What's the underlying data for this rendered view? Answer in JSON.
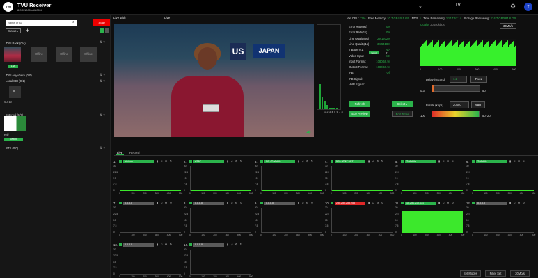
{
  "header": {
    "logo": "TVU",
    "title": "TVU Receiver",
    "version": "8.0.0.1000build0016",
    "user": "TVI",
    "avatar": "T"
  },
  "sidebar": {
    "search_placeholder": "Name or ID",
    "stop_label": "Stop",
    "status_label": "Status ▾",
    "add_label": "+",
    "tvu_pack": {
      "title": "TVU Pack (0/4)",
      "tiles": [
        "",
        "Offline",
        "Offline",
        "Offline"
      ],
      "live": "Live"
    },
    "tvu_anywhere": {
      "title": "TVU Anywhere (0/0)"
    },
    "local_sdi": {
      "title": "Local SDI (0/1)",
      "name": "SDI #0"
    },
    "external": {
      "title": "External (0/7)",
      "name": "ext2",
      "setting": "Setting"
    },
    "rts": {
      "title": "RTS (0/0)"
    },
    "collapse_label": "⇅ ∨"
  },
  "video": {
    "tab1": "Live with",
    "tab2": "Live",
    "sign_us": "US",
    "sign_japan": "JAPAN"
  },
  "meters": {
    "labels": "1 2 3 4 5 6 7 8",
    "levels": [
      0.3,
      0.15,
      0.1,
      0.05,
      0.0,
      0.0,
      0.0,
      0.0
    ]
  },
  "top_stats": {
    "idle_cpu_label": "Idle CPU:",
    "idle_cpu": "77%",
    "free_memory_label": "Free Memory:",
    "free_memory": "10.7 GB/15.5 GB",
    "ntp_label": "NTP:",
    "ntp": "✓",
    "time_remaining_label": "Time Remaining:",
    "time_remaining": "1d 17:51:14",
    "storage_label": "Storage Remaining:",
    "storage": "274.7 GB/884.8 GB"
  },
  "stats": [
    {
      "k": "Error Rate(9s)",
      "v": "0%"
    },
    {
      "k": "Error Rate(1s)",
      "v": "0%"
    },
    {
      "k": "Line Quality(9s)",
      "v": "29.1932%"
    },
    {
      "k": "Line Quality(1s)",
      "v": "34.5418%"
    },
    {
      "k": "T Battery 1:",
      "v": "N/A"
    },
    {
      "k": "Video Input:",
      "v": "SDI"
    },
    {
      "k": "Input Format:",
      "v": "1080i59.94"
    },
    {
      "k": "Output Format:",
      "v": "1080i59.94"
    },
    {
      "k": "IFB:",
      "v": "Off"
    },
    {
      "k": "IFB Signal:",
      "v": ""
    },
    {
      "k": "VoIP Signal:",
      "v": ""
    }
  ],
  "battery_badge": "Good",
  "battery2_label": "2:",
  "buttons": {
    "refresh": "Refresh",
    "select": "Select ▾",
    "eco_preview": "Eco Preview",
    "edit_timer": "Edit Timer"
  },
  "quality": {
    "title_prefix": "Quality",
    "title_value": "20480kbps",
    "badge": "30Mb/s",
    "x_ticks": [
      "0",
      "100",
      "200",
      "300",
      "400",
      "500"
    ],
    "ticks_label": ""
  },
  "delay": {
    "label": "Delay (second)",
    "value": "1.2",
    "fixed": "Fixed",
    "min": "0.3",
    "max": "50",
    "fraction": 0.018
  },
  "bitrate": {
    "label": "Bitrate (kbps)",
    "value": "20480",
    "mode": "VBR",
    "min": "100",
    "max": "50720",
    "fraction": 0.4
  },
  "lower_tabs": {
    "live": "Live",
    "record": "Record"
  },
  "channels": [
    {
      "num": "1.",
      "label": "Verizon",
      "color": "#2bb34b",
      "level": 0.05
    },
    {
      "num": "2.",
      "label": "AT&T",
      "color": "#2bb34b",
      "level": 0.05
    },
    {
      "num": "3.",
      "label": "5G - T-Mobile",
      "color": "#2bb34b",
      "level": 0.05
    },
    {
      "num": "4.",
      "label": "5G - AT&T 5GT",
      "color": "#2bb34b",
      "level": 0.05
    },
    {
      "num": "5.",
      "label": "T-Mobile",
      "color": "#2bb34b",
      "level": 0.05
    },
    {
      "num": "6.",
      "label": "T-Mobile",
      "color": "#2bb34b",
      "level": 0.05
    },
    {
      "num": "7.",
      "label": "0.0.0.0",
      "color": "#5a5a5a",
      "level": 0
    },
    {
      "num": "8.",
      "label": "0.0.0.0",
      "color": "#5a5a5a",
      "level": 0
    },
    {
      "num": "9.",
      "label": "0.0.0.0",
      "color": "#5a5a5a",
      "level": 0
    },
    {
      "num": "10.",
      "label": "255.255.255.255",
      "color": "#e02828",
      "level": 0
    },
    {
      "num": "11.",
      "label": "10.251.210.131",
      "color": "#2bb34b",
      "level": 0.85
    },
    {
      "num": "12.",
      "label": "0.0.0.0",
      "color": "#5a5a5a",
      "level": 0
    },
    {
      "num": "13.",
      "label": "0.0.0.0",
      "color": "#5a5a5a",
      "level": 0
    },
    {
      "num": "14.",
      "label": "0.0.0.0",
      "color": "#5a5a5a",
      "level": 0
    }
  ],
  "mini_y": [
    "30",
    "22.5",
    "15",
    "7.5",
    "0"
  ],
  "mini_x": [
    "0",
    "100",
    "200",
    "300",
    "400",
    "500"
  ],
  "mini_icons": "▮ ♫ ⚙ ↻",
  "bottom": {
    "set_modes": "Set Modes",
    "filter_set": "Filter Set",
    "mbps": "30Mb/s"
  }
}
